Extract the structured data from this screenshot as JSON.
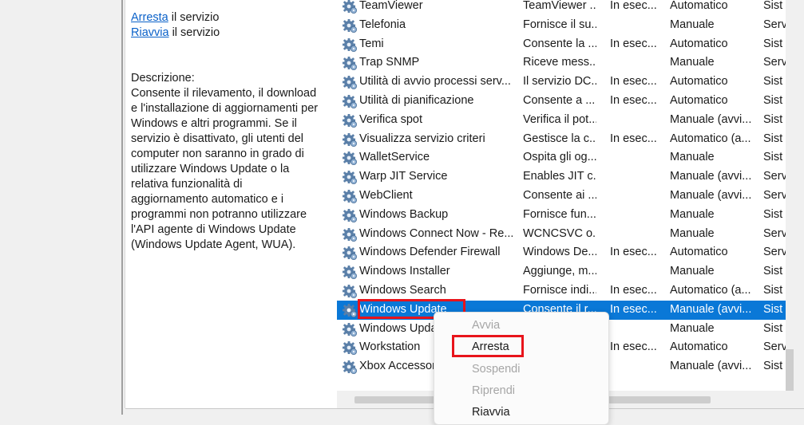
{
  "actions": {
    "stop_link": "Arresta",
    "stop_suffix": " il servizio",
    "restart_link": "Riavvia",
    "restart_suffix": " il servizio"
  },
  "description": {
    "label": "Descrizione:",
    "lines": [
      "Consente il rilevamento, il download",
      "e l'installazione di aggiornamenti per",
      "Windows e altri programmi. Se il",
      "servizio è disattivato, gli utenti del",
      "computer non saranno in grado di",
      "utilizzare Windows Update o la",
      "relativa funzionalità di",
      "aggiornamento automatico e i",
      "programmi non potranno utilizzare",
      "l'API agente di Windows Update",
      "(Windows Update Agent, WUA)."
    ]
  },
  "services": [
    {
      "name": "TeamViewer",
      "desc": "TeamViewer ...",
      "state": "In esec...",
      "start": "Automatico",
      "account": "Sist"
    },
    {
      "name": "Telefonia",
      "desc": "Fornisce il su...",
      "state": "",
      "start": "Manuale",
      "account": "Serv"
    },
    {
      "name": "Temi",
      "desc": "Consente la ...",
      "state": "In esec...",
      "start": "Automatico",
      "account": "Sist"
    },
    {
      "name": "Trap SNMP",
      "desc": "Riceve mess...",
      "state": "",
      "start": "Manuale",
      "account": "Serv"
    },
    {
      "name": "Utilità di avvio processi serv...",
      "desc": "Il servizio DC...",
      "state": "In esec...",
      "start": "Automatico",
      "account": "Sist"
    },
    {
      "name": "Utilità di pianificazione",
      "desc": "Consente a ...",
      "state": "In esec...",
      "start": "Automatico",
      "account": "Sist"
    },
    {
      "name": "Verifica spot",
      "desc": "Verifica il pot...",
      "state": "",
      "start": "Manuale (avvi...",
      "account": "Sist"
    },
    {
      "name": "Visualizza servizio criteri",
      "desc": "Gestisce la c...",
      "state": "In esec...",
      "start": "Automatico (a...",
      "account": "Sist"
    },
    {
      "name": "WalletService",
      "desc": "Ospita gli og...",
      "state": "",
      "start": "Manuale",
      "account": "Sist"
    },
    {
      "name": "Warp JIT Service",
      "desc": "Enables JIT c...",
      "state": "",
      "start": "Manuale (avvi...",
      "account": "Serv"
    },
    {
      "name": "WebClient",
      "desc": "Consente ai ...",
      "state": "",
      "start": "Manuale (avvi...",
      "account": "Serv"
    },
    {
      "name": "Windows Backup",
      "desc": "Fornisce fun...",
      "state": "",
      "start": "Manuale",
      "account": "Sist"
    },
    {
      "name": "Windows Connect Now - Re...",
      "desc": "WCNCSVC o...",
      "state": "",
      "start": "Manuale",
      "account": "Serv"
    },
    {
      "name": "Windows Defender Firewall",
      "desc": "Windows De...",
      "state": "In esec...",
      "start": "Automatico",
      "account": "Serv"
    },
    {
      "name": "Windows Installer",
      "desc": "Aggiunge, m...",
      "state": "",
      "start": "Manuale",
      "account": "Sist"
    },
    {
      "name": "Windows Search",
      "desc": "Fornisce indi...",
      "state": "In esec...",
      "start": "Automatico (a...",
      "account": "Sist"
    },
    {
      "name": "Windows Update",
      "desc": "Consente il r...",
      "state": "In esec...",
      "start": "Manuale (avvi...",
      "account": "Sist"
    },
    {
      "name": "Windows Update Medic Service",
      "desc": "",
      "state": "",
      "start": "Manuale",
      "account": "Sist"
    },
    {
      "name": "Workstation",
      "desc": "",
      "state": "In esec...",
      "start": "Automatico",
      "account": "Serv"
    },
    {
      "name": "Xbox Accessory Management...",
      "desc": "",
      "state": "",
      "start": "Manuale (avvi...",
      "account": "Sist"
    }
  ],
  "selected_index": 16,
  "context_menu": {
    "items": [
      {
        "label": "Avvia",
        "enabled": false
      },
      {
        "label": "Arresta",
        "enabled": true
      },
      {
        "label": "Sospendi",
        "enabled": false
      },
      {
        "label": "Riprendi",
        "enabled": false
      },
      {
        "label": "Riavvia",
        "enabled": true
      }
    ]
  },
  "colors": {
    "selection": "#0a78d7",
    "link": "#0a61c9",
    "highlight_box": "#e8141b"
  },
  "icons": {
    "service": "gear-icon"
  }
}
